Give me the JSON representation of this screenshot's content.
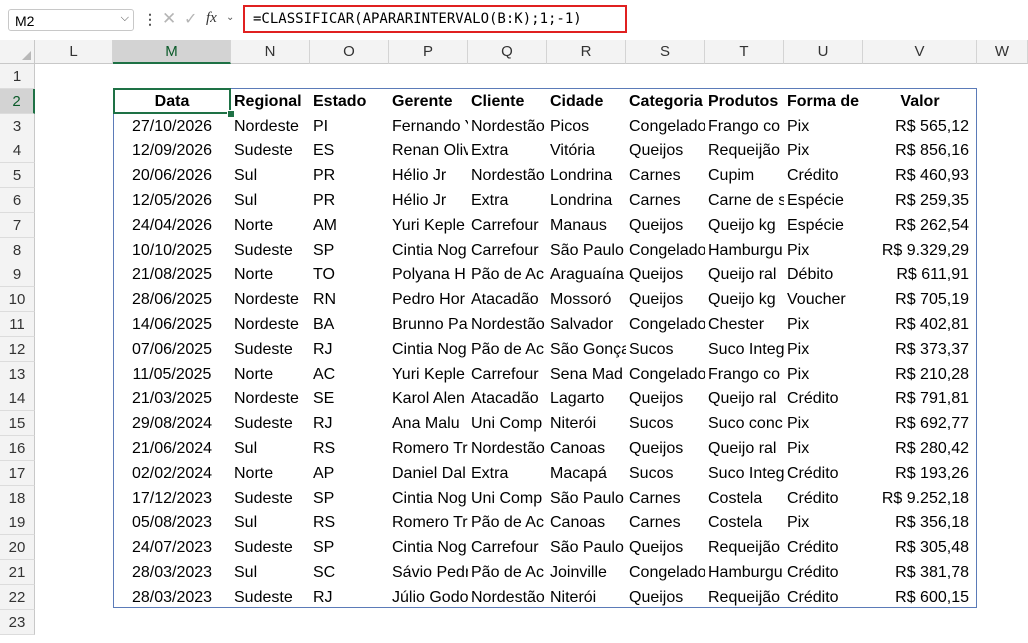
{
  "formula_bar": {
    "name_box": "M2",
    "cancel_icon": "close-icon",
    "enter_icon": "check-icon",
    "fx_label": "fx",
    "formula": "=CLASSIFICAR(APARARINTERVALO(B:K);1;-1)"
  },
  "columns": [
    "L",
    "M",
    "N",
    "O",
    "P",
    "Q",
    "R",
    "S",
    "T",
    "U",
    "V",
    "W"
  ],
  "active_column": "M",
  "rows": [
    "1",
    "2",
    "3",
    "4",
    "5",
    "6",
    "7",
    "8",
    "9",
    "10",
    "11",
    "12",
    "13",
    "14",
    "15",
    "16",
    "17",
    "18",
    "19",
    "20",
    "21",
    "22",
    "23"
  ],
  "active_row": "2",
  "table": {
    "headers": [
      "Data",
      "Regional",
      "Estado",
      "Gerente",
      "Cliente",
      "Cidade",
      "Categoria",
      "Produtos",
      "Forma de",
      "Valor"
    ],
    "records": [
      [
        "27/10/2026",
        "Nordeste",
        "PI",
        "Fernando Y",
        "Nordestão",
        "Picos",
        "Congelado",
        "Frango co",
        "Pix",
        "R$ 565,12"
      ],
      [
        "12/09/2026",
        "Sudeste",
        "ES",
        "Renan Oliv",
        "Extra",
        "Vitória",
        "Queijos",
        "Requeijão",
        "Pix",
        "R$ 856,16"
      ],
      [
        "20/06/2026",
        "Sul",
        "PR",
        "Hélio Jr",
        "Nordestão",
        "Londrina",
        "Carnes",
        "Cupim",
        "Crédito",
        "R$ 460,93"
      ],
      [
        "12/05/2026",
        "Sul",
        "PR",
        "Hélio Jr",
        "Extra",
        "Londrina",
        "Carnes",
        "Carne de s",
        "Espécie",
        "R$ 259,35"
      ],
      [
        "24/04/2026",
        "Norte",
        "AM",
        "Yuri Keple",
        "Carrefour",
        "Manaus",
        "Queijos",
        "Queijo kg",
        "Espécie",
        "R$ 262,54"
      ],
      [
        "10/10/2025",
        "Sudeste",
        "SP",
        "Cintia Nog",
        "Carrefour",
        "São Paulo",
        "Congelado",
        "Hamburgu",
        "Pix",
        "R$ 9.329,29"
      ],
      [
        "21/08/2025",
        "Norte",
        "TO",
        "Polyana H",
        "Pão de Ac",
        "Araguaína",
        "Queijos",
        "Queijo ral",
        "Débito",
        "R$ 611,91"
      ],
      [
        "28/06/2025",
        "Nordeste",
        "RN",
        "Pedro Hor",
        "Atacadão",
        "Mossoró",
        "Queijos",
        "Queijo kg",
        "Voucher",
        "R$ 705,19"
      ],
      [
        "14/06/2025",
        "Nordeste",
        "BA",
        "Brunno Pa",
        "Nordestão",
        "Salvador",
        "Congelado",
        "Chester",
        "Pix",
        "R$ 402,81"
      ],
      [
        "07/06/2025",
        "Sudeste",
        "RJ",
        "Cintia Nog",
        "Pão de Ac",
        "São Gonça",
        "Sucos",
        "Suco Integ",
        "Pix",
        "R$ 373,37"
      ],
      [
        "11/05/2025",
        "Norte",
        "AC",
        "Yuri Keple",
        "Carrefour",
        "Sena Mad",
        "Congelado",
        "Frango co",
        "Pix",
        "R$ 210,28"
      ],
      [
        "21/03/2025",
        "Nordeste",
        "SE",
        "Karol Alen",
        "Atacadão",
        "Lagarto",
        "Queijos",
        "Queijo ral",
        "Crédito",
        "R$ 791,81"
      ],
      [
        "29/08/2024",
        "Sudeste",
        "RJ",
        "Ana Malu",
        "Uni Comp",
        "Niterói",
        "Sucos",
        "Suco conc",
        "Pix",
        "R$ 692,77"
      ],
      [
        "21/06/2024",
        "Sul",
        "RS",
        "Romero Tr",
        "Nordestão",
        "Canoas",
        "Queijos",
        "Queijo ral",
        "Pix",
        "R$ 280,42"
      ],
      [
        "02/02/2024",
        "Norte",
        "AP",
        "Daniel Dal",
        "Extra",
        "Macapá",
        "Sucos",
        "Suco Integ",
        "Crédito",
        "R$ 193,26"
      ],
      [
        "17/12/2023",
        "Sudeste",
        "SP",
        "Cintia Nog",
        "Uni Comp",
        "São Paulo",
        "Carnes",
        "Costela",
        "Crédito",
        "R$ 9.252,18"
      ],
      [
        "05/08/2023",
        "Sul",
        "RS",
        "Romero Tr",
        "Pão de Ac",
        "Canoas",
        "Carnes",
        "Costela",
        "Pix",
        "R$ 356,18"
      ],
      [
        "24/07/2023",
        "Sudeste",
        "SP",
        "Cintia Nog",
        "Carrefour",
        "São Paulo",
        "Queijos",
        "Requeijão",
        "Crédito",
        "R$ 305,48"
      ],
      [
        "28/03/2023",
        "Sul",
        "SC",
        "Sávio Pedr",
        "Pão de Ac",
        "Joinville",
        "Congelado",
        "Hamburgu",
        "Crédito",
        "R$ 381,78"
      ],
      [
        "28/03/2023",
        "Sudeste",
        "RJ",
        "Júlio Godo",
        "Nordestão",
        "Niterói",
        "Queijos",
        "Requeijão",
        "Crédito",
        "R$ 600,15"
      ]
    ]
  },
  "colors": {
    "selection": "#1e7145",
    "formula_highlight": "#e02020",
    "table_border": "#5b7bb8"
  }
}
